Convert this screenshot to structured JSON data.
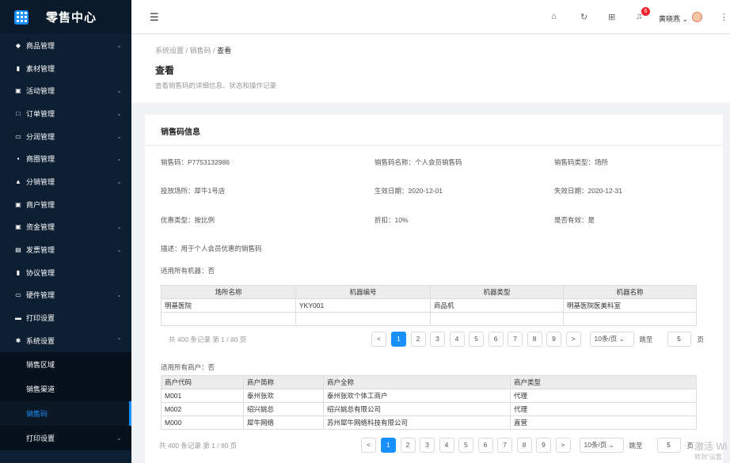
{
  "app": {
    "title": "零售中心"
  },
  "sidebar": {
    "items": [
      {
        "label": "商品管理",
        "icon": "tag-icon",
        "glyph": "◆",
        "expand": true
      },
      {
        "label": "素材管理",
        "icon": "file-icon",
        "glyph": "▮",
        "expand": false
      },
      {
        "label": "活动管理",
        "icon": "calendar-icon",
        "glyph": "▣",
        "expand": true
      },
      {
        "label": "订单管理",
        "icon": "order-icon",
        "glyph": "□",
        "expand": true
      },
      {
        "label": "分润管理",
        "icon": "monitor-icon",
        "glyph": "▭",
        "expand": true
      },
      {
        "label": "商圈管理",
        "icon": "grid-icon",
        "glyph": "▪",
        "expand": true
      },
      {
        "label": "分销管理",
        "icon": "home-icon",
        "glyph": "▲",
        "expand": true
      },
      {
        "label": "商户管理",
        "icon": "merchant-icon",
        "glyph": "▣",
        "expand": false
      },
      {
        "label": "资金管理",
        "icon": "wallet-icon",
        "glyph": "▣",
        "expand": true
      },
      {
        "label": "发票管理",
        "icon": "invoice-icon",
        "glyph": "▤",
        "expand": true
      },
      {
        "label": "协议管理",
        "icon": "agreement-icon",
        "glyph": "▮",
        "expand": false
      },
      {
        "label": "硬件管理",
        "icon": "device-icon",
        "glyph": "▭",
        "expand": true
      },
      {
        "label": "打印设置",
        "icon": "printer-icon",
        "glyph": "▬",
        "expand": false
      },
      {
        "label": "系统设置",
        "icon": "gear-icon",
        "glyph": "✱",
        "expand": true
      }
    ],
    "subitems": [
      "销售区域",
      "销售渠道",
      "销售码",
      "打印设置"
    ]
  },
  "topbar": {
    "user": "黄晓燕",
    "notifications": "6"
  },
  "breadcrumb": [
    "系统设置",
    "销售码",
    "查看"
  ],
  "page": {
    "title": "查看",
    "desc": "查看销售码的详细信息、状态和操作记录"
  },
  "card": {
    "title": "销售码信息"
  },
  "fields": [
    "销售码：P7753132986",
    "销售码名称：个人会员销售码",
    "销售码类型：场所",
    "投放场所：犀牛1号店",
    "生效日期：2020-12-01",
    "失效日期：2020-12-31",
    "优惠类型：按比例",
    "折扣：10%",
    "是否有效：是",
    "描述：用于个人会员优惠的销售码",
    "适用所有机器：否"
  ],
  "machines": {
    "headers": [
      "场所名称",
      "机器编号",
      "机器类型",
      "机器名称"
    ],
    "rows": [
      [
        "明基医院",
        "YKY001",
        "商品机",
        "明基医院医美科室"
      ],
      [
        "",
        "",
        "",
        ""
      ]
    ]
  },
  "pager1": {
    "total": "共 400 条记录 第 1 / 80 页"
  },
  "merchants_label": "适用所有商户：否",
  "merchants": {
    "headers": [
      "商户代码",
      "商户简称",
      "商户全称",
      "商户类型"
    ],
    "rows": [
      [
        "M001",
        "泰州张欢",
        "泰州张欢个体工商户",
        "代理"
      ],
      [
        "M002",
        "绍兴姚总",
        "绍兴姚总有限公司",
        "代理"
      ],
      [
        "M000",
        "犀牛网络",
        "苏州犀牛网络科技有限公司",
        "直营"
      ]
    ]
  },
  "pager2": {
    "total": "共 400 条记录 第 1 / 80 页"
  },
  "pager": {
    "pages": [
      "1",
      "2",
      "3",
      "4",
      "5",
      "6",
      "7",
      "8",
      "9"
    ],
    "prev": "<",
    "next": ">",
    "size": "10条/页",
    "jump": "跳至",
    "jump_value": "5",
    "page_unit": "页"
  },
  "watermark": {
    "line1": "激活 Wi",
    "line2": "转到\"设置"
  }
}
